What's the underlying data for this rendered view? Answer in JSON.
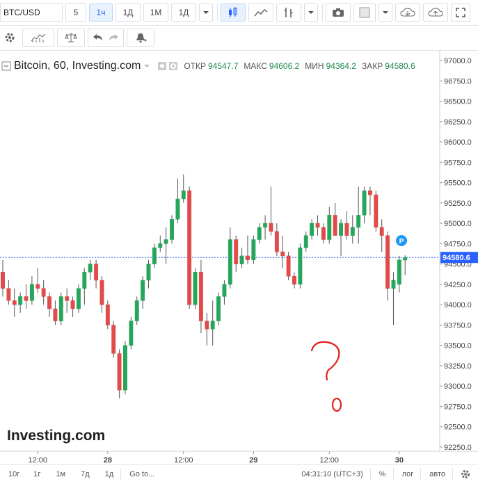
{
  "toolbar": {
    "symbol": "BTC/USD",
    "intervals": [
      "5",
      "1ч",
      "1Д",
      "1М",
      "1Д"
    ],
    "active_interval": "1ч"
  },
  "legend": {
    "title": "Bitcoin, 60, Investing.com",
    "open_label": "ОТКР",
    "open_value": "94547.7",
    "high_label": "МАКС",
    "high_value": "94606.2",
    "low_label": "МИН",
    "low_value": "94364.2",
    "close_label": "ЗАКР",
    "close_value": "94580.6"
  },
  "watermark": "Investing.com",
  "price_marker": "P",
  "bottom": {
    "ranges": [
      "10г",
      "1г",
      "1м",
      "7д",
      "1д"
    ],
    "goto": "Go to...",
    "clock": "04:31:10 (UTC+3)",
    "percent": "%",
    "log": "лог",
    "auto": "авто"
  },
  "colors": {
    "up": "#26a65b",
    "down": "#e04b4b",
    "last_price_line": "#2962ff",
    "annotation": "#e02020"
  },
  "chart_data": {
    "type": "candlestick",
    "title": "Bitcoin, 60, Investing.com",
    "xlabel": "",
    "ylabel": "",
    "ylim": [
      92250,
      97000
    ],
    "y_ticks": [
      "97000.0",
      "96750.0",
      "96500.0",
      "96250.0",
      "96000.0",
      "95750.0",
      "95500.0",
      "95250.0",
      "95000.0",
      "94750.0",
      "94500.0",
      "94250.0",
      "94000.0",
      "93750.0",
      "93500.0",
      "93250.0",
      "93000.0",
      "92750.0",
      "92500.0",
      "92250.0"
    ],
    "x_ticks": [
      {
        "label": "12:00",
        "index": 6
      },
      {
        "label": "28",
        "index": 18
      },
      {
        "label": "12:00",
        "index": 31
      },
      {
        "label": "29",
        "index": 43
      },
      {
        "label": "12:00",
        "index": 56
      },
      {
        "label": "30",
        "index": 68
      }
    ],
    "last_price": 94580.6,
    "last_price_label": "94580.6",
    "candles": [
      {
        "o": 94400,
        "h": 94550,
        "l": 94100,
        "c": 94200
      },
      {
        "o": 94200,
        "h": 94300,
        "l": 94000,
        "c": 94050
      },
      {
        "o": 94050,
        "h": 94200,
        "l": 93850,
        "c": 94000
      },
      {
        "o": 94000,
        "h": 94150,
        "l": 93900,
        "c": 94100
      },
      {
        "o": 94100,
        "h": 94250,
        "l": 93950,
        "c": 94050
      },
      {
        "o": 94050,
        "h": 94350,
        "l": 94000,
        "c": 94250
      },
      {
        "o": 94250,
        "h": 94450,
        "l": 94150,
        "c": 94200
      },
      {
        "o": 94200,
        "h": 94300,
        "l": 94000,
        "c": 94100
      },
      {
        "o": 94100,
        "h": 94150,
        "l": 93850,
        "c": 93950
      },
      {
        "o": 93950,
        "h": 94050,
        "l": 93750,
        "c": 93800
      },
      {
        "o": 93800,
        "h": 94150,
        "l": 93750,
        "c": 94100
      },
      {
        "o": 94100,
        "h": 94200,
        "l": 93900,
        "c": 94050
      },
      {
        "o": 94050,
        "h": 94100,
        "l": 93850,
        "c": 93950
      },
      {
        "o": 93950,
        "h": 94250,
        "l": 93900,
        "c": 94200
      },
      {
        "o": 94200,
        "h": 94450,
        "l": 94000,
        "c": 94400
      },
      {
        "o": 94400,
        "h": 94550,
        "l": 94300,
        "c": 94500
      },
      {
        "o": 94500,
        "h": 94550,
        "l": 94200,
        "c": 94300
      },
      {
        "o": 94300,
        "h": 94350,
        "l": 93900,
        "c": 94000
      },
      {
        "o": 94000,
        "h": 94050,
        "l": 93700,
        "c": 93750
      },
      {
        "o": 93750,
        "h": 93800,
        "l": 93350,
        "c": 93400
      },
      {
        "o": 93400,
        "h": 93450,
        "l": 92850,
        "c": 92950
      },
      {
        "o": 92950,
        "h": 93550,
        "l": 92900,
        "c": 93500
      },
      {
        "o": 93500,
        "h": 93850,
        "l": 93450,
        "c": 93800
      },
      {
        "o": 93800,
        "h": 94100,
        "l": 93750,
        "c": 94050
      },
      {
        "o": 94050,
        "h": 94350,
        "l": 93950,
        "c": 94300
      },
      {
        "o": 94300,
        "h": 94550,
        "l": 94200,
        "c": 94500
      },
      {
        "o": 94500,
        "h": 94750,
        "l": 94450,
        "c": 94700
      },
      {
        "o": 94700,
        "h": 94850,
        "l": 94650,
        "c": 94750
      },
      {
        "o": 94750,
        "h": 94950,
        "l": 94500,
        "c": 94800
      },
      {
        "o": 94800,
        "h": 95100,
        "l": 94750,
        "c": 95050
      },
      {
        "o": 95050,
        "h": 95550,
        "l": 95000,
        "c": 95300
      },
      {
        "o": 95300,
        "h": 95600,
        "l": 95250,
        "c": 95400
      },
      {
        "o": 95400,
        "h": 95450,
        "l": 93950,
        "c": 94000
      },
      {
        "o": 94000,
        "h": 94450,
        "l": 93950,
        "c": 94400
      },
      {
        "o": 94400,
        "h": 94550,
        "l": 93650,
        "c": 93800
      },
      {
        "o": 93800,
        "h": 93900,
        "l": 93500,
        "c": 93700
      },
      {
        "o": 93700,
        "h": 94050,
        "l": 93500,
        "c": 93800
      },
      {
        "o": 93800,
        "h": 94150,
        "l": 93750,
        "c": 94100
      },
      {
        "o": 94100,
        "h": 94300,
        "l": 94000,
        "c": 94250
      },
      {
        "o": 94250,
        "h": 94950,
        "l": 94200,
        "c": 94800
      },
      {
        "o": 94800,
        "h": 94850,
        "l": 94400,
        "c": 94500
      },
      {
        "o": 94500,
        "h": 94700,
        "l": 94450,
        "c": 94600
      },
      {
        "o": 94600,
        "h": 94850,
        "l": 94500,
        "c": 94550
      },
      {
        "o": 94550,
        "h": 94850,
        "l": 94500,
        "c": 94800
      },
      {
        "o": 94800,
        "h": 95000,
        "l": 94750,
        "c": 94950
      },
      {
        "o": 94950,
        "h": 95100,
        "l": 94800,
        "c": 95000
      },
      {
        "o": 95000,
        "h": 95450,
        "l": 94850,
        "c": 94900
      },
      {
        "o": 94900,
        "h": 95000,
        "l": 94600,
        "c": 94650
      },
      {
        "o": 94650,
        "h": 94850,
        "l": 94450,
        "c": 94600
      },
      {
        "o": 94600,
        "h": 94650,
        "l": 94300,
        "c": 94350
      },
      {
        "o": 94350,
        "h": 94400,
        "l": 94200,
        "c": 94250
      },
      {
        "o": 94250,
        "h": 94750,
        "l": 94200,
        "c": 94700
      },
      {
        "o": 94700,
        "h": 94900,
        "l": 94650,
        "c": 94850
      },
      {
        "o": 94850,
        "h": 95050,
        "l": 94800,
        "c": 95000
      },
      {
        "o": 95000,
        "h": 95100,
        "l": 94850,
        "c": 94950
      },
      {
        "o": 94950,
        "h": 95000,
        "l": 94750,
        "c": 94800
      },
      {
        "o": 94800,
        "h": 95200,
        "l": 94750,
        "c": 95100
      },
      {
        "o": 95100,
        "h": 95250,
        "l": 94850,
        "c": 94850
      },
      {
        "o": 94850,
        "h": 95050,
        "l": 94600,
        "c": 95000
      },
      {
        "o": 95000,
        "h": 95150,
        "l": 94800,
        "c": 94850
      },
      {
        "o": 94850,
        "h": 95100,
        "l": 94750,
        "c": 94950
      },
      {
        "o": 94950,
        "h": 95450,
        "l": 94750,
        "c": 95100
      },
      {
        "o": 95100,
        "h": 95450,
        "l": 95000,
        "c": 95400
      },
      {
        "o": 95400,
        "h": 95450,
        "l": 95100,
        "c": 95350
      },
      {
        "o": 95350,
        "h": 95400,
        "l": 94900,
        "c": 94950
      },
      {
        "o": 94950,
        "h": 95050,
        "l": 94650,
        "c": 94850
      },
      {
        "o": 94850,
        "h": 94900,
        "l": 94050,
        "c": 94200
      },
      {
        "o": 94200,
        "h": 94400,
        "l": 93750,
        "c": 94300
      },
      {
        "o": 94250,
        "h": 94600,
        "l": 94150,
        "c": 94550
      },
      {
        "o": 94547.7,
        "h": 94606.2,
        "l": 94364.2,
        "c": 94580.6
      }
    ]
  }
}
